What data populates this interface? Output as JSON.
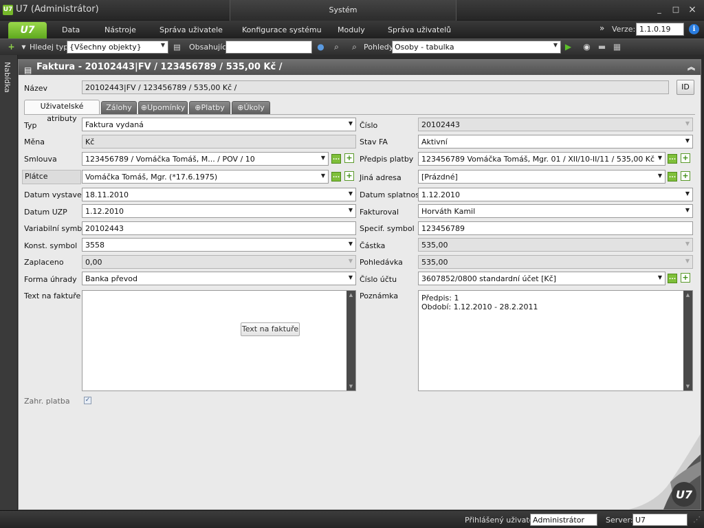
{
  "window": {
    "logo": "U7",
    "title": "U7 (Administrátor)",
    "center_title": "Systém",
    "minimize": "_",
    "maximize": "□",
    "close": "×"
  },
  "menu": {
    "logo": "U7",
    "items": [
      "Data",
      "Nástroje",
      "Správa uživatele",
      "Konfigurace systému",
      "Moduly",
      "Správa uživatelů"
    ],
    "version_label": "Verze:",
    "version_value": "1.1.0.19"
  },
  "toolbar": {
    "search_type_label": "Hledej typ",
    "search_type_value": "{Všechny objekty}",
    "contains_label": "Obsahující",
    "contains_value": "",
    "views_label": "Pohledy",
    "views_value": "Osoby - tabulka"
  },
  "side_panel": {
    "label": "Nabídka"
  },
  "panel": {
    "title": "Faktura - 20102443|FV / 123456789 / 535,00 Kč /",
    "name_label": "Název",
    "name_value": "20102443|FV / 123456789 / 535,00 Kč /",
    "id_button": "ID"
  },
  "tabs": [
    {
      "label": "Uživatelské atributy",
      "active": true
    },
    {
      "label": "Zálohy",
      "active": false
    },
    {
      "label": "Upomínky",
      "active": false
    },
    {
      "label": "Platby",
      "active": false
    },
    {
      "label": "Úkoly",
      "active": false
    }
  ],
  "form": {
    "typ": {
      "label": "Typ",
      "value": "Faktura vydaná"
    },
    "mena": {
      "label": "Měna",
      "value": "Kč"
    },
    "smlouva": {
      "label": "Smlouva",
      "value": "123456789 / Vomáčka Tomáš, M... / POV / 10"
    },
    "platce": {
      "label": "Plátce",
      "value": "Vomáčka Tomáš, Mgr. (*17.6.1975)"
    },
    "datum_vystaveni": {
      "label": "Datum vystavení",
      "value": "18.11.2010"
    },
    "datum_uzp": {
      "label": "Datum UZP",
      "value": "1.12.2010"
    },
    "variabilni_symbol": {
      "label": "Variabilní symbol",
      "value": "20102443"
    },
    "konst_symbol": {
      "label": "Konst. symbol",
      "value": "3558"
    },
    "zaplaceno": {
      "label": "Zaplaceno",
      "value": "0,00"
    },
    "forma_uhrady": {
      "label": "Forma úhrady",
      "value": "Banka převod"
    },
    "text_na_fakture": {
      "label": "Text na faktuře",
      "button": "Text na faktuře"
    },
    "cislo": {
      "label": "Číslo",
      "value": "20102443"
    },
    "stav_fa": {
      "label": "Stav FA",
      "value": "Aktivní"
    },
    "predpis_platby": {
      "label": "Předpis platby",
      "value": "123456789 Vomáčka Tomáš, Mgr. 01 / XII/10-II/11 / 535,00 Kč"
    },
    "jina_adresa": {
      "label": "Jiná adresa",
      "value": "[Prázdné]"
    },
    "datum_splatnosti": {
      "label": "Datum splatnosti",
      "value": "1.12.2010"
    },
    "fakturoval": {
      "label": "Fakturoval",
      "value": "Horváth Kamil"
    },
    "specif_symbol": {
      "label": "Specif. symbol",
      "value": "123456789"
    },
    "castka": {
      "label": "Částka",
      "value": "535,00"
    },
    "pohledavka": {
      "label": "Pohledávka",
      "value": "535,00"
    },
    "cislo_uctu": {
      "label": "Číslo účtu",
      "value": "3607852/0800 standardní účet [Kč]"
    },
    "poznamka": {
      "label": "Poznámka",
      "line1": "Předpis: 1",
      "line2": "Období: 1.12.2010 - 28.2.2011"
    },
    "zahr_platba": {
      "label": "Zahr. platba",
      "checked": true
    }
  },
  "statusbar": {
    "user_label": "Přihlášený uživatel:",
    "user_value": "Administrátor",
    "server_label": "Server:",
    "server_value": "U7"
  }
}
